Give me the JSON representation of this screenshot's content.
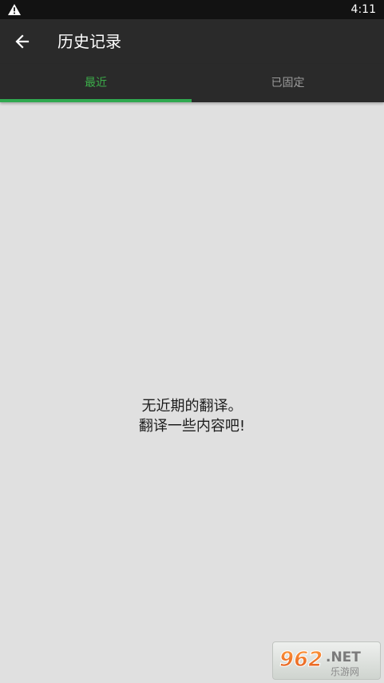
{
  "status_bar": {
    "time": "4:11",
    "warning_icon": "warning-icon"
  },
  "app_bar": {
    "back_icon": "arrow-left-icon",
    "title": "历史记录"
  },
  "tabs": [
    {
      "label": "最近",
      "selected": true,
      "color": "#3cad4a"
    },
    {
      "label": "已固定",
      "selected": false,
      "color": "#9a9a9a"
    }
  ],
  "empty_state": {
    "line1": "无近期的翻译。",
    "line2": "翻译一些内容吧!"
  },
  "watermark": {
    "logo_text": "962.NET",
    "subtitle": "乐游网"
  },
  "colors": {
    "accent": "#2fa84f",
    "toolbar_bg": "#2a2a2a",
    "content_bg": "#e0e0e0"
  }
}
